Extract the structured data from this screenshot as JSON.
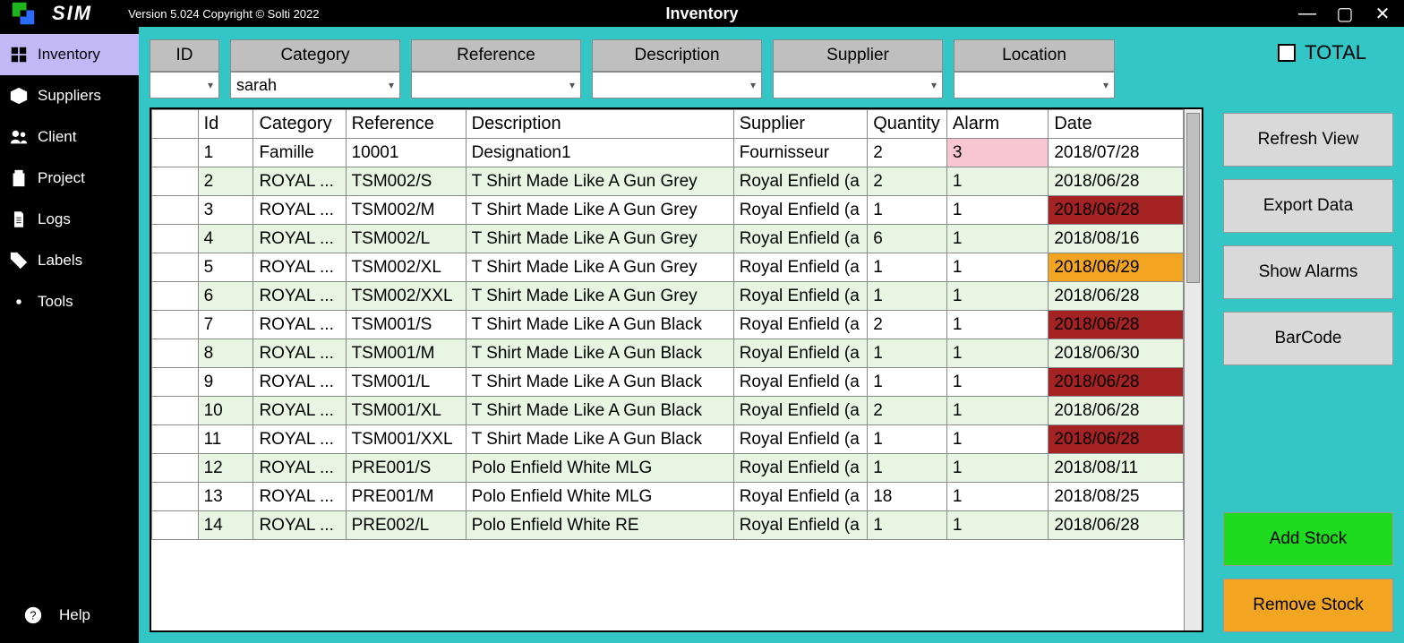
{
  "app": {
    "title": "SIM",
    "version": "Version 5.024  Copyright © Solti 2022",
    "page": "Inventory"
  },
  "win": {
    "min": "—",
    "max": "▢",
    "close": "✕"
  },
  "sidebar": {
    "items": [
      {
        "label": "Inventory"
      },
      {
        "label": "Suppliers"
      },
      {
        "label": "Client"
      },
      {
        "label": "Project"
      },
      {
        "label": "Logs"
      },
      {
        "label": "Labels"
      },
      {
        "label": "Tools"
      }
    ],
    "help": "Help"
  },
  "filters": {
    "heads": [
      "ID",
      "Category",
      "Reference",
      "Description",
      "Supplier",
      "Location"
    ],
    "values": {
      "id": "",
      "category": "sarah",
      "reference": "",
      "description": "",
      "supplier": "",
      "location": ""
    },
    "total_label": "TOTAL"
  },
  "table": {
    "columns": [
      "Id",
      "Category",
      "Reference",
      "Description",
      "Supplier",
      "Quantity",
      "Alarm",
      "Date"
    ],
    "rows": [
      {
        "id": "1",
        "cat": "Famille",
        "ref": "10001",
        "desc": "Designation1",
        "sup": "Fournisseur",
        "qty": "2",
        "alm": "3",
        "date": "2018/07/28",
        "alm_pink": true
      },
      {
        "id": "2",
        "cat": "ROYAL ...",
        "ref": "TSM002/S",
        "desc": "T Shirt Made Like A Gun Grey",
        "sup": "Royal Enfield (a",
        "qty": "2",
        "alm": "1",
        "date": "2018/06/28",
        "green": true,
        "date_red": true
      },
      {
        "id": "3",
        "cat": "ROYAL ...",
        "ref": "TSM002/M",
        "desc": "T Shirt Made Like A Gun Grey",
        "sup": "Royal Enfield (a",
        "qty": "1",
        "alm": "1",
        "date": "2018/06/28",
        "date_red": true
      },
      {
        "id": "4",
        "cat": "ROYAL ...",
        "ref": "TSM002/L",
        "desc": "T Shirt Made Like A Gun Grey",
        "sup": "Royal Enfield (a",
        "qty": "6",
        "alm": "1",
        "date": "2018/08/16",
        "green": true
      },
      {
        "id": "5",
        "cat": "ROYAL ...",
        "ref": "TSM002/XL",
        "desc": "T Shirt Made Like A Gun Grey",
        "sup": "Royal Enfield (a",
        "qty": "1",
        "alm": "1",
        "date": "2018/06/29",
        "date_orange": true
      },
      {
        "id": "6",
        "cat": "ROYAL ...",
        "ref": "TSM002/XXL",
        "desc": "T Shirt Made Like A Gun Grey",
        "sup": "Royal Enfield (a",
        "qty": "1",
        "alm": "1",
        "date": "2018/06/28",
        "green": true,
        "date_red": true
      },
      {
        "id": "7",
        "cat": "ROYAL ...",
        "ref": "TSM001/S",
        "desc": "T Shirt Made Like A Gun Black",
        "sup": "Royal Enfield (a",
        "qty": "2",
        "alm": "1",
        "date": "2018/06/28",
        "date_red": true
      },
      {
        "id": "8",
        "cat": "ROYAL ...",
        "ref": "TSM001/M",
        "desc": "T Shirt Made Like A Gun Black",
        "sup": "Royal Enfield (a",
        "qty": "1",
        "alm": "1",
        "date": "2018/06/30",
        "green": true,
        "date_orange": true
      },
      {
        "id": "9",
        "cat": "ROYAL ...",
        "ref": "TSM001/L",
        "desc": "T Shirt Made Like A Gun Black",
        "sup": "Royal Enfield (a",
        "qty": "1",
        "alm": "1",
        "date": "2018/06/28",
        "date_red": true
      },
      {
        "id": "10",
        "cat": "ROYAL ...",
        "ref": "TSM001/XL",
        "desc": "T Shirt Made Like A Gun Black",
        "sup": "Royal Enfield (a",
        "qty": "2",
        "alm": "1",
        "date": "2018/06/28",
        "green": true,
        "date_red": true
      },
      {
        "id": "11",
        "cat": "ROYAL ...",
        "ref": "TSM001/XXL",
        "desc": "T Shirt Made Like A Gun Black",
        "sup": "Royal Enfield (a",
        "qty": "1",
        "alm": "1",
        "date": "2018/06/28",
        "date_red": true
      },
      {
        "id": "12",
        "cat": "ROYAL ...",
        "ref": "PRE001/S",
        "desc": "Polo Enfield White MLG",
        "sup": "Royal Enfield (a",
        "qty": "1",
        "alm": "1",
        "date": "2018/08/11",
        "green": true
      },
      {
        "id": "13",
        "cat": "ROYAL ...",
        "ref": "PRE001/M",
        "desc": "Polo Enfield White MLG",
        "sup": "Royal Enfield (a",
        "qty": "18",
        "alm": "1",
        "date": "2018/08/25"
      },
      {
        "id": "14",
        "cat": "ROYAL ...",
        "ref": "PRE002/L",
        "desc": "Polo Enfield White RE",
        "sup": "Royal Enfield (a",
        "qty": "1",
        "alm": "1",
        "date": "2018/06/28",
        "green": true,
        "date_red": true
      }
    ]
  },
  "buttons": {
    "refresh": "Refresh View",
    "export": "Export Data",
    "alarms": "Show Alarms",
    "barcode": "BarCode",
    "add": "Add Stock",
    "remove": "Remove Stock"
  }
}
